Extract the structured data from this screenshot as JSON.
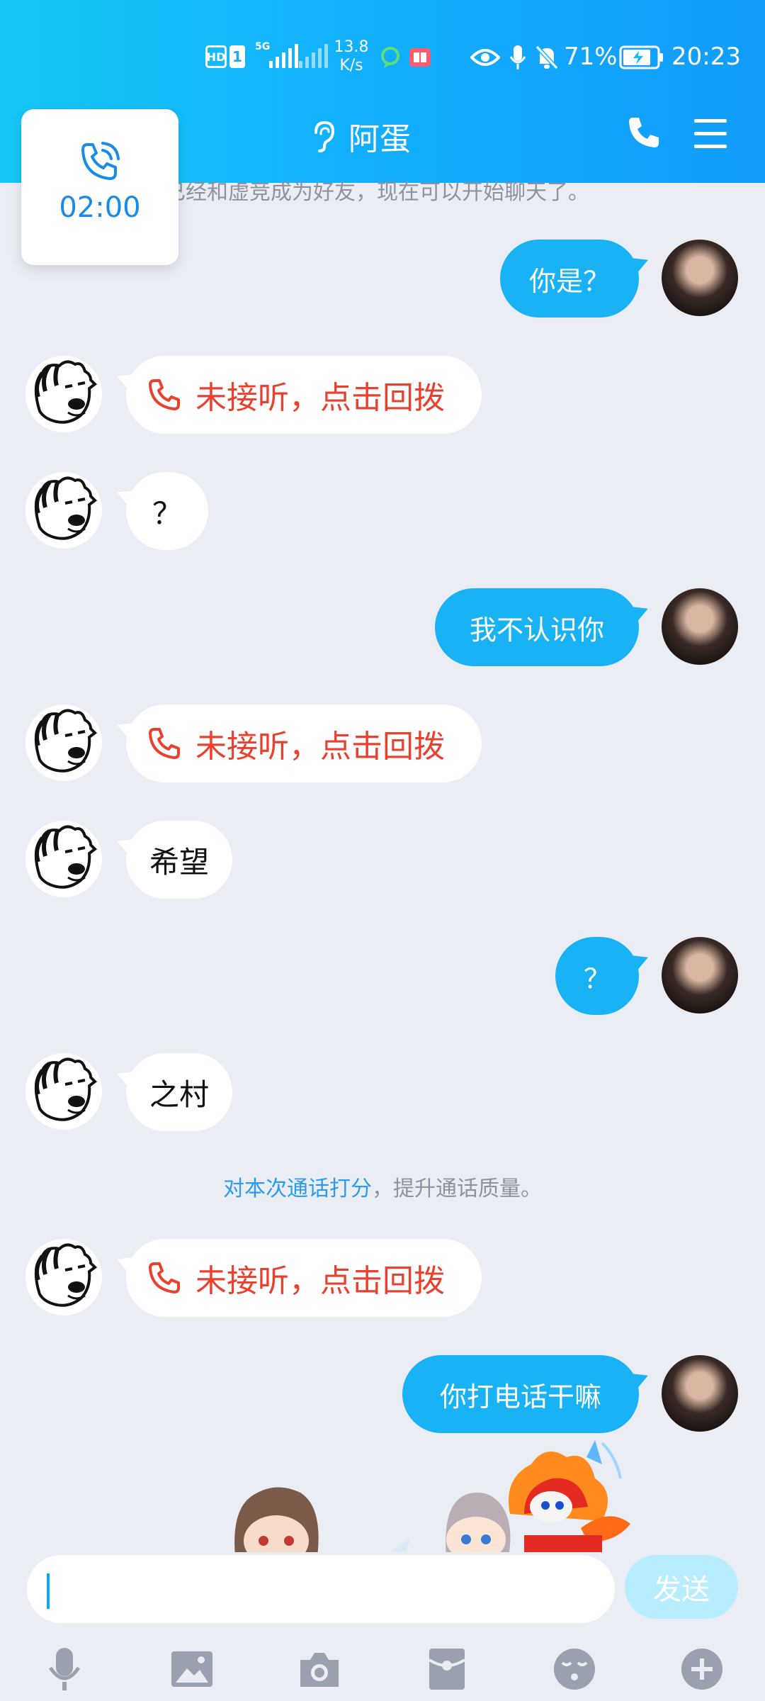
{
  "status": {
    "hd": "HD",
    "sim": "1",
    "network": "5G",
    "speed_value": "13.8",
    "speed_unit": "K/s",
    "battery": "71%",
    "time": "20:23"
  },
  "header": {
    "contact_name": "阿蛋"
  },
  "call_float": {
    "timer": "02:00"
  },
  "system_top": "已经和虚竞成为好友，现在可以开始聊天了。",
  "messages": [
    {
      "from": "me",
      "text": "你是？"
    },
    {
      "from": "friend",
      "text": "未接听，点击回拨",
      "type": "missed-call"
    },
    {
      "from": "friend",
      "text": "？"
    },
    {
      "from": "me",
      "text": "我不认识你"
    },
    {
      "from": "friend",
      "text": "未接听，点击回拨",
      "type": "missed-call"
    },
    {
      "from": "friend",
      "text": "希望"
    },
    {
      "from": "me",
      "text": "？"
    },
    {
      "from": "friend",
      "text": "之村"
    },
    {
      "from": "friend",
      "text": "未接听，点击回拨",
      "type": "missed-call"
    },
    {
      "from": "me",
      "text": "你打电话干嘛"
    }
  ],
  "rate_notice": {
    "link": "对本次通话打分",
    "rest": "，提升通话质量。"
  },
  "input": {
    "value": "",
    "send_label": "发送"
  },
  "colors": {
    "header_start": "#16c8f7",
    "header_end": "#129cfc",
    "my_bubble": "#19b2f5",
    "missed_call": "#e8412f",
    "background": "#eaedf4"
  }
}
